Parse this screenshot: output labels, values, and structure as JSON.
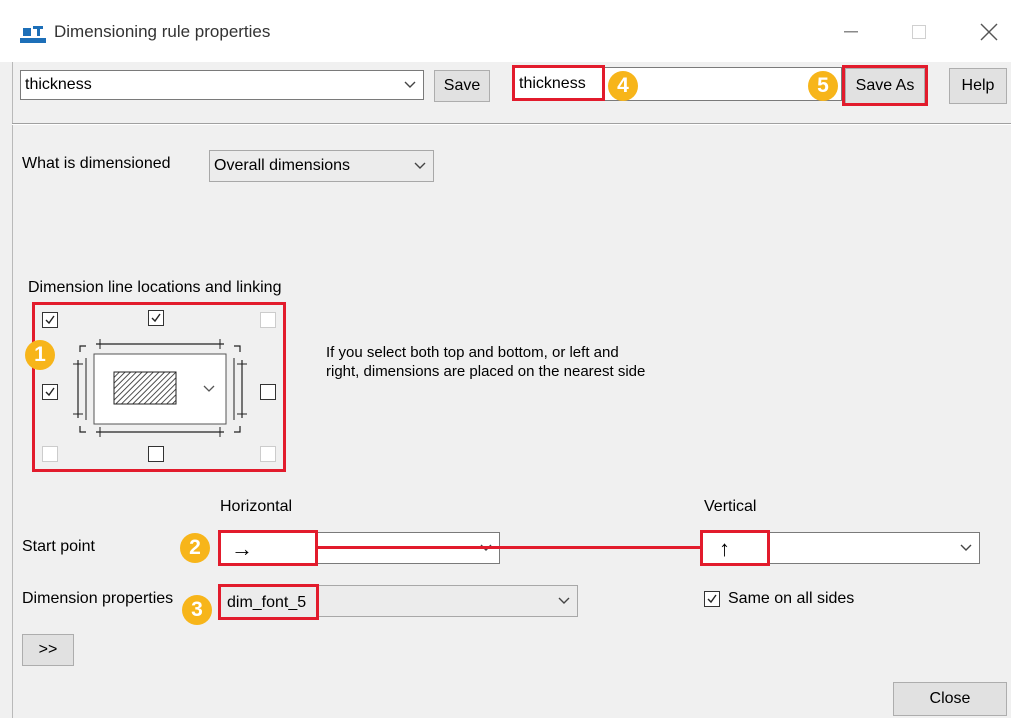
{
  "window": {
    "title": "Dimensioning rule properties",
    "controls": [
      "minimize-icon",
      "maximize-icon",
      "close-icon"
    ]
  },
  "toolbar": {
    "rule_select_value": "thickness",
    "save_label": "Save",
    "name_input_value": "thickness",
    "save_as_label": "Save As",
    "help_label": "Help"
  },
  "what_is_dimensioned": {
    "label": "What is dimensioned",
    "value": "Overall dimensions"
  },
  "dimension_lines": {
    "heading": "Dimension line locations and linking",
    "note_line1": "If you select both top and bottom, or left and",
    "note_line2": "right, dimensions are placed on the nearest side",
    "checkboxes": {
      "top_left": true,
      "top": true,
      "top_right": false,
      "left": true,
      "right": false,
      "bottom_left": false,
      "bottom": false,
      "bottom_right": false
    }
  },
  "start_point": {
    "label": "Start point",
    "horizontal_heading": "Horizontal",
    "vertical_heading": "Vertical",
    "horizontal_glyph": "→",
    "vertical_glyph": "↑"
  },
  "dimension_properties": {
    "label": "Dimension properties",
    "value": "dim_font_5"
  },
  "same_on_all_sides": {
    "label": "Same on all sides",
    "checked": true
  },
  "expand_label": ">>",
  "close_label": "Close",
  "callouts": [
    "1",
    "2",
    "3",
    "4",
    "5"
  ],
  "colors": {
    "highlight_red": "#e21b2c",
    "callout_yellow": "#f7b51a",
    "dialog_bg": "#f0f0f0"
  }
}
